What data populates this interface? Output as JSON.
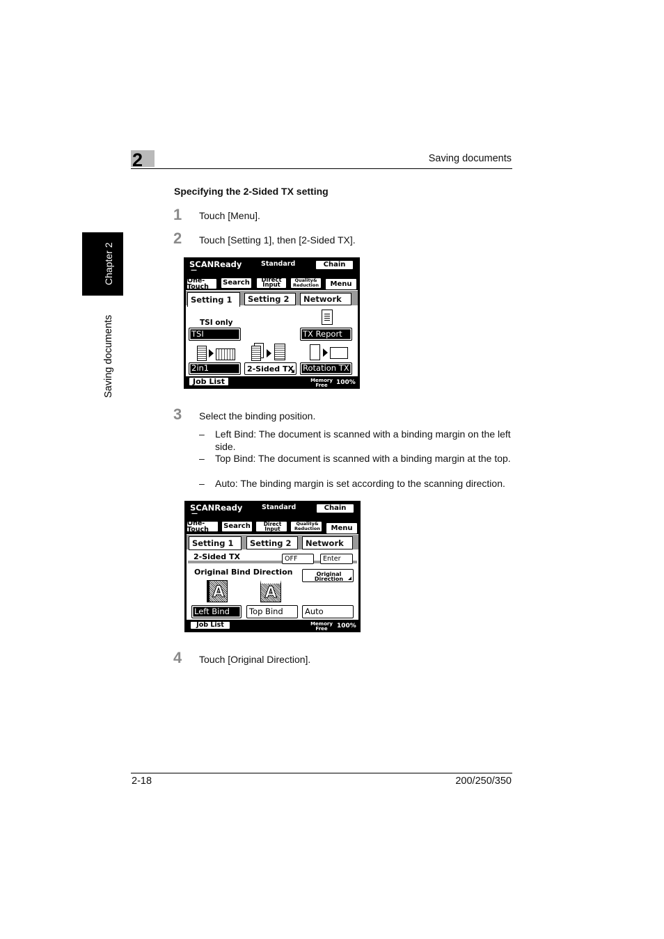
{
  "header": {
    "chapter_number": "2",
    "title": "Saving documents"
  },
  "side_tab": {
    "chapter": "Chapter 2",
    "section": "Saving documents"
  },
  "section_heading": "Specifying the 2-Sided TX setting",
  "steps": [
    {
      "number": "1",
      "text": "Touch [Menu]."
    },
    {
      "number": "2",
      "text": "Touch [Setting 1], then [2-Sided TX]."
    },
    {
      "number": "3",
      "text": "Select the binding position."
    },
    {
      "number": "4",
      "text": "Touch [Original Direction]."
    }
  ],
  "bullets": [
    {
      "dash": "–",
      "text": "Left Bind: The document is scanned with a binding margin on the left side."
    },
    {
      "dash": "–",
      "text": "Top Bind: The document is scanned with a binding margin at the top."
    },
    {
      "dash": "–",
      "text": "Auto: The binding margin is set according to the scanning direction."
    }
  ],
  "screen1": {
    "status": "SCANReady",
    "status_sub": "—",
    "mode": "Standard",
    "chain": "Chain",
    "top_tabs": [
      "One-Touch",
      "Search",
      "Direct Input",
      "Quality& Reduction",
      "Menu"
    ],
    "setting_tabs": [
      "Setting 1",
      "Setting 2",
      "Network"
    ],
    "tsi_only": "TSI only",
    "tsi": "TSI",
    "tx_report": "TX Report",
    "two_in_one": "2in1",
    "two_sided": "2-Sided TX",
    "rotation": "Rotation TX",
    "job_list": "Job List",
    "memory": "Memory Free",
    "memory_value": "100%"
  },
  "screen2": {
    "status": "SCANReady",
    "status_sub": "—",
    "mode": "Standard",
    "chain": "Chain",
    "top_tabs": [
      "One-Touch",
      "Search",
      "Direct Input",
      "Quality& Reduction",
      "Menu"
    ],
    "setting_tabs": [
      "Setting 1",
      "Setting 2",
      "Network"
    ],
    "two_sided": "2-Sided TX",
    "off": "OFF",
    "enter": "Enter",
    "bind_direction": "Original Bind Direction",
    "original_direction": "Original Direction",
    "icon_letter": "A",
    "left_bind": "Left Bind",
    "top_bind": "Top Bind",
    "auto": "Auto",
    "job_list": "Job List",
    "memory": "Memory Free",
    "memory_value": "100%"
  },
  "footer": {
    "page": "2-18",
    "models": "200/250/350"
  }
}
